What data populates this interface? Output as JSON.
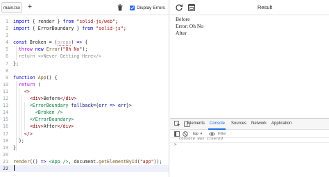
{
  "editor": {
    "file_tab": "main.tsx",
    "add_tab": "+",
    "display_errors_label": "Display Errors",
    "display_errors_checked": true,
    "lines": [
      {
        "n": "1",
        "tokens": [
          [
            "kw",
            "import"
          ],
          [
            "pl",
            " { render } "
          ],
          [
            "kw",
            "from"
          ],
          [
            "pl",
            " "
          ],
          [
            "str",
            "\"solid-js/web\""
          ],
          [
            "pl",
            ";"
          ]
        ]
      },
      {
        "n": "2",
        "tokens": [
          [
            "kw",
            "import"
          ],
          [
            "pl",
            " { ErrorBoundary } "
          ],
          [
            "kw",
            "from"
          ],
          [
            "pl",
            " "
          ],
          [
            "str",
            "\"solid-js\""
          ],
          [
            "pl",
            ";"
          ]
        ]
      },
      {
        "n": "3",
        "tokens": []
      },
      {
        "n": "4",
        "tokens": [
          [
            "kw",
            "const"
          ],
          [
            "pl",
            " Broken = ("
          ],
          [
            "unused",
            "props"
          ],
          [
            "pl",
            ") "
          ],
          [
            "kw",
            "=>"
          ],
          [
            "pl",
            " {"
          ]
        ]
      },
      {
        "n": "5",
        "tokens": [
          [
            "pl",
            "  "
          ],
          [
            "kw2",
            "throw"
          ],
          [
            "pl",
            " "
          ],
          [
            "kw",
            "new"
          ],
          [
            "pl",
            " "
          ],
          [
            "fn",
            "Error"
          ],
          [
            "pl",
            "("
          ],
          [
            "str",
            "\"Oh No\""
          ],
          [
            "pl",
            ");"
          ]
        ]
      },
      {
        "n": "6",
        "tokens": [
          [
            "pl",
            "  "
          ],
          [
            "cm",
            "return <>Never Getting Here</>"
          ]
        ]
      },
      {
        "n": "7",
        "tokens": [
          [
            "pl",
            "};"
          ]
        ]
      },
      {
        "n": "8",
        "tokens": []
      },
      {
        "n": "9",
        "tokens": [
          [
            "kw",
            "function"
          ],
          [
            "pl",
            " "
          ],
          [
            "fn",
            "App"
          ],
          [
            "pl",
            "() {"
          ]
        ]
      },
      {
        "n": "10",
        "tokens": [
          [
            "pl",
            "  "
          ],
          [
            "kw2",
            "return"
          ],
          [
            "pl",
            " ("
          ]
        ]
      },
      {
        "n": "11",
        "tokens": [
          [
            "pl",
            "    "
          ],
          [
            "tag",
            "<>"
          ]
        ]
      },
      {
        "n": "12",
        "tokens": [
          [
            "pl",
            "      "
          ],
          [
            "tag",
            "<div>"
          ],
          [
            "pl",
            "Before"
          ],
          [
            "tag",
            "</div>"
          ]
        ]
      },
      {
        "n": "13",
        "tokens": [
          [
            "pl",
            "      "
          ],
          [
            "jsx",
            "<ErrorBoundary"
          ],
          [
            "pl",
            " "
          ],
          [
            "var",
            "fallback"
          ],
          [
            "pl",
            "={"
          ],
          [
            "var",
            "err"
          ],
          [
            "pl",
            " "
          ],
          [
            "kw",
            "=>"
          ],
          [
            "pl",
            " "
          ],
          [
            "var",
            "err"
          ],
          [
            "pl",
            "}>"
          ]
        ]
      },
      {
        "n": "14",
        "tokens": [
          [
            "pl",
            "        "
          ],
          [
            "jsx",
            "<Broken />"
          ]
        ]
      },
      {
        "n": "15",
        "tokens": [
          [
            "pl",
            "      "
          ],
          [
            "jsx",
            "</ErrorBoundary>"
          ]
        ]
      },
      {
        "n": "16",
        "tokens": [
          [
            "pl",
            "      "
          ],
          [
            "tag",
            "<div>"
          ],
          [
            "pl",
            "After"
          ],
          [
            "tag",
            "</div>"
          ]
        ]
      },
      {
        "n": "17",
        "tokens": [
          [
            "pl",
            "    "
          ],
          [
            "tag",
            "</>"
          ]
        ]
      },
      {
        "n": "18",
        "tokens": [
          [
            "pl",
            "  );"
          ]
        ]
      },
      {
        "n": "19",
        "tokens": [
          [
            "pl",
            "}"
          ]
        ]
      },
      {
        "n": "20",
        "tokens": []
      },
      {
        "n": "21",
        "tokens": [
          [
            "fn",
            "render"
          ],
          [
            "pl",
            "(() "
          ],
          [
            "kw",
            "=>"
          ],
          [
            "pl",
            " "
          ],
          [
            "jsx",
            "<App />"
          ],
          [
            "pl",
            ", document."
          ],
          [
            "fn",
            "getElementById"
          ],
          [
            "pl",
            "("
          ],
          [
            "str",
            "\"app\""
          ],
          [
            "pl",
            "));"
          ]
        ]
      },
      {
        "n": "22",
        "tokens": [],
        "active": true
      }
    ]
  },
  "result": {
    "title": "Result",
    "preview_lines": [
      "Before",
      "Error: Oh No",
      "After"
    ]
  },
  "devtools": {
    "tabs": [
      "Elements",
      "Console",
      "Sources",
      "Network",
      "Application"
    ],
    "active_tab": "Console",
    "context": "top",
    "filter_placeholder": "Filter",
    "message": "Console was cleared",
    "prompt": ">"
  },
  "colors": {
    "accent": "#1a73e8",
    "checkbox": "#2563eb",
    "keyword": "#0000cc",
    "string": "#a31515",
    "comment": "#8a8a8a",
    "jsx": "#0a7a3e"
  }
}
